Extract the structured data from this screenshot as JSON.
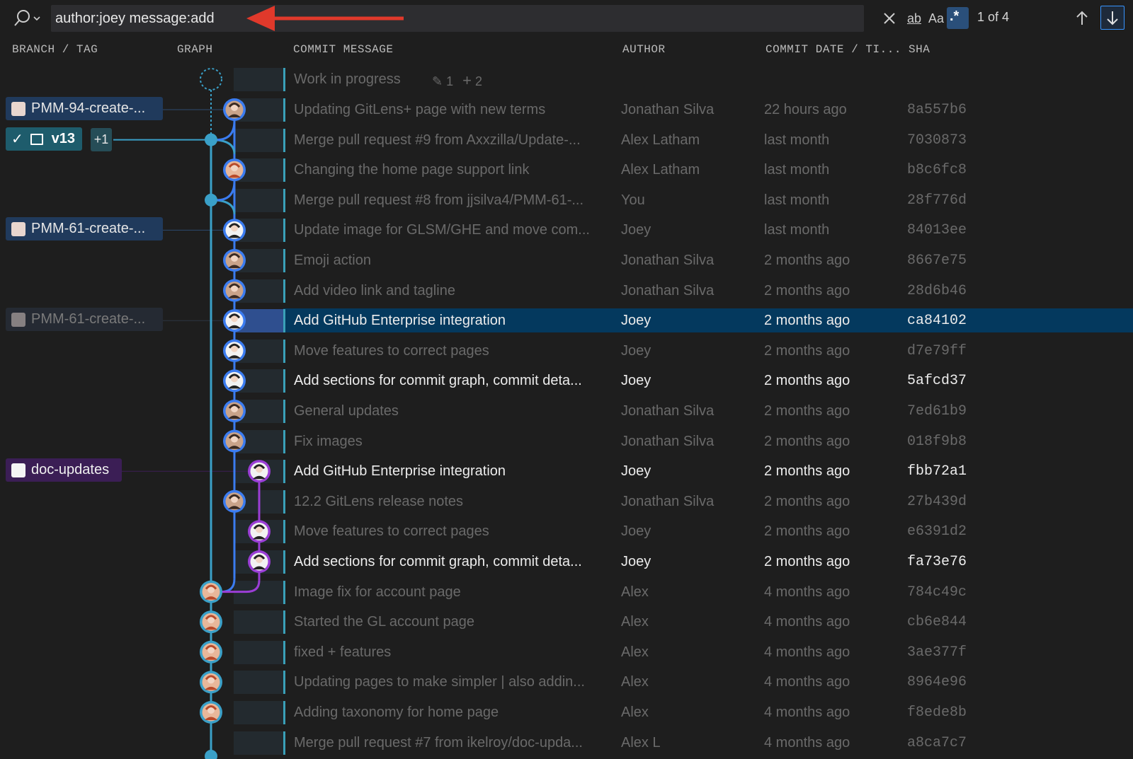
{
  "search": {
    "query": "author:joey message:add",
    "match_count": "1 of 4",
    "toggle_whole_word": "ab",
    "toggle_match_case": "Aa",
    "toggle_regex": ".*"
  },
  "columns": {
    "branch": "BRANCH / TAG",
    "graph": "GRAPH",
    "message": "COMMIT MESSAGE",
    "author": "AUTHOR",
    "date": "COMMIT DATE / TI...",
    "sha": "SHA"
  },
  "wip": {
    "message": "Work in progress",
    "modified": "1",
    "added": "2"
  },
  "refs": {
    "pmm94": "PMM-94-create-...",
    "v13": "v13",
    "plus_one": "+1",
    "pmm61a": "PMM-61-create-...",
    "pmm61b": "PMM-61-create-...",
    "doc_updates": "doc-updates"
  },
  "commits": [
    {
      "message": "Updating GitLens+ page with new terms",
      "author": "Jonathan Silva",
      "date": "22 hours ago",
      "sha": "8a557b6"
    },
    {
      "message": "Merge pull request #9 from Axxzilla/Update-...",
      "author": "Alex Latham",
      "date": "last month",
      "sha": "7030873"
    },
    {
      "message": "Changing the home page support link",
      "author": "Alex Latham",
      "date": "last month",
      "sha": "b8c6fc8"
    },
    {
      "message": "Merge pull request #8 from jjsilva4/PMM-61-...",
      "author": "You",
      "date": "last month",
      "sha": "28f776d"
    },
    {
      "message": "Update image for GLSM/GHE and move com...",
      "author": "Joey",
      "date": "last month",
      "sha": "84013ee"
    },
    {
      "message": "Emoji action",
      "author": "Jonathan Silva",
      "date": "2 months ago",
      "sha": "8667e75"
    },
    {
      "message": "Add video link and tagline",
      "author": "Jonathan Silva",
      "date": "2 months ago",
      "sha": "28d6b46"
    },
    {
      "message": "Add GitHub Enterprise integration",
      "author": "Joey",
      "date": "2 months ago",
      "sha": "ca84102"
    },
    {
      "message": "Move features to correct pages",
      "author": "Joey",
      "date": "2 months ago",
      "sha": "d7e79ff"
    },
    {
      "message": "Add sections for commit graph, commit deta...",
      "author": "Joey",
      "date": "2 months ago",
      "sha": "5afcd37"
    },
    {
      "message": "General updates",
      "author": "Jonathan Silva",
      "date": "2 months ago",
      "sha": "7ed61b9"
    },
    {
      "message": "Fix images",
      "author": "Jonathan Silva",
      "date": "2 months ago",
      "sha": "018f9b8"
    },
    {
      "message": "Add GitHub Enterprise integration",
      "author": "Joey",
      "date": "2 months ago",
      "sha": "fbb72a1"
    },
    {
      "message": "12.2 GitLens release notes",
      "author": "Jonathan Silva",
      "date": "2 months ago",
      "sha": "27b439d"
    },
    {
      "message": "Move features to correct pages",
      "author": "Joey",
      "date": "2 months ago",
      "sha": "e6391d2"
    },
    {
      "message": "Add sections for commit graph, commit deta...",
      "author": "Joey",
      "date": "2 months ago",
      "sha": "fa73e76"
    },
    {
      "message": "Image fix for account page",
      "author": "Alex",
      "date": "4 months ago",
      "sha": "784c49c"
    },
    {
      "message": "Started the GL account page",
      "author": "Alex",
      "date": "4 months ago",
      "sha": "cb6e844"
    },
    {
      "message": "fixed + features",
      "author": "Alex",
      "date": "4 months ago",
      "sha": "3ae377f"
    },
    {
      "message": "Updating pages to make simpler | also addin...",
      "author": "Alex",
      "date": "4 months ago",
      "sha": "8964e96"
    },
    {
      "message": "Adding taxonomy for home page",
      "author": "Alex",
      "date": "4 months ago",
      "sha": "f8ede8b"
    },
    {
      "message": "Merge pull request #7 from ikelroy/doc-upda...",
      "author": "Alex L",
      "date": "4 months ago",
      "sha": "a8ca7c7"
    }
  ],
  "colors": {
    "lane_main": "#3aa0c8",
    "lane_blue": "#3b7cf0",
    "lane_purple": "#9b3ed6",
    "selected_row": "#04395e",
    "annotation_arrow": "#e0392b"
  }
}
